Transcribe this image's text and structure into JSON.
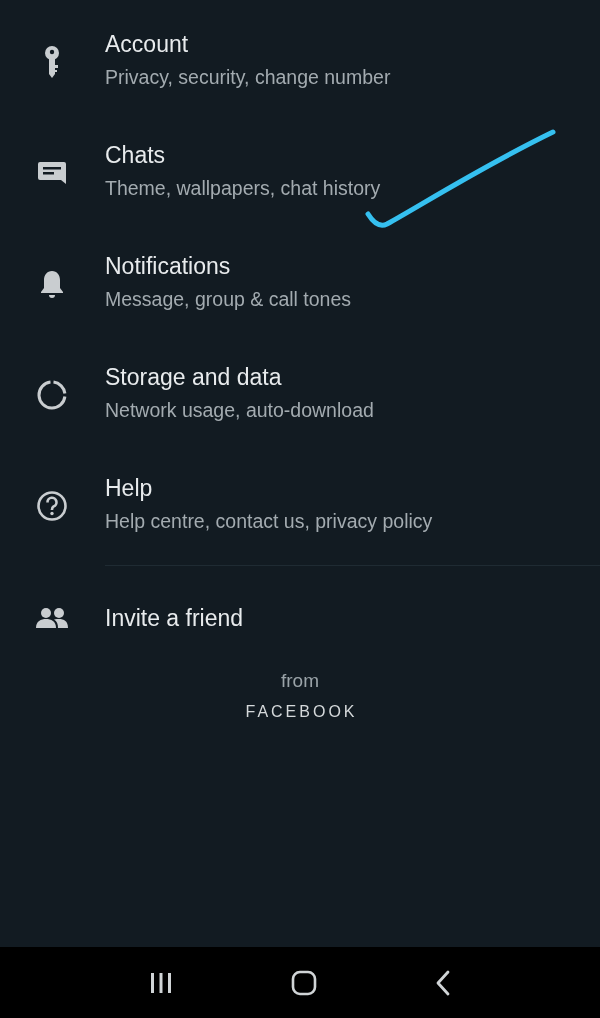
{
  "settings": [
    {
      "title": "Account",
      "subtitle": "Privacy, security, change number"
    },
    {
      "title": "Chats",
      "subtitle": "Theme, wallpapers, chat history"
    },
    {
      "title": "Notifications",
      "subtitle": "Message, group & call tones"
    },
    {
      "title": "Storage and data",
      "subtitle": "Network usage, auto-download"
    },
    {
      "title": "Help",
      "subtitle": "Help centre, contact us, privacy policy"
    }
  ],
  "invite": {
    "title": "Invite a friend"
  },
  "footer": {
    "from": "from",
    "brand": "FACEBOOK"
  }
}
